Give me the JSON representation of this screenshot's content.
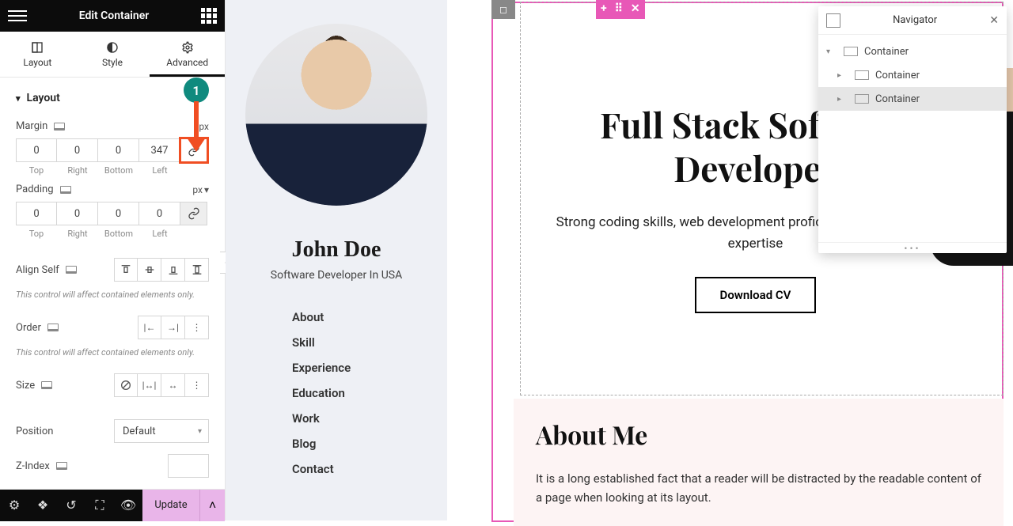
{
  "panel": {
    "title": "Edit Container",
    "tabs": {
      "layout": "Layout",
      "style": "Style",
      "advanced": "Advanced"
    },
    "section_layout": "Layout",
    "margin": {
      "label": "Margin",
      "unit": "px",
      "top": "0",
      "right": "0",
      "bottom": "0",
      "left": "347",
      "sub": {
        "top": "Top",
        "right": "Right",
        "bottom": "Bottom",
        "left": "Left"
      }
    },
    "padding": {
      "label": "Padding",
      "unit": "px",
      "top": "0",
      "right": "0",
      "bottom": "0",
      "left": "0",
      "sub": {
        "top": "Top",
        "right": "Right",
        "bottom": "Bottom",
        "left": "Left"
      }
    },
    "align_self": "Align Self",
    "note1": "This control will affect contained elements only.",
    "order": "Order",
    "note2": "This control will affect contained elements only.",
    "size": "Size",
    "position": {
      "label": "Position",
      "value": "Default"
    },
    "zindex": "Z-Index",
    "update": "Update"
  },
  "callout": {
    "num": "1"
  },
  "profile": {
    "name": "John Doe",
    "role": "Software Developer In USA",
    "menu": [
      "About",
      "Skill",
      "Experience",
      "Education",
      "Work",
      "Blog",
      "Contact"
    ]
  },
  "hero": {
    "title": "Full Stack Software Developer",
    "subtitle": "Strong coding skills, web development proficiency, problem-solving expertise",
    "cta": "Download CV"
  },
  "about": {
    "heading": "About Me",
    "text": "It is a long established fact that a reader will be distracted by the readable content of a page when looking at its layout."
  },
  "navigator": {
    "title": "Navigator",
    "items": [
      "Container",
      "Container",
      "Container"
    ]
  }
}
